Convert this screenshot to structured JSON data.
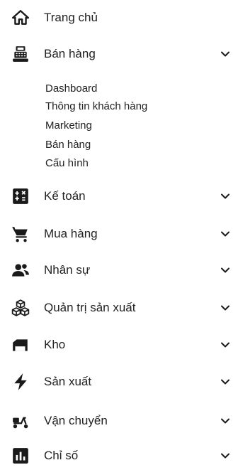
{
  "menu": {
    "items": [
      {
        "label": "Trang chủ",
        "icon": "home-icon"
      },
      {
        "label": "Bán hàng",
        "icon": "cash-register-icon"
      },
      {
        "label": "Kế toán",
        "icon": "calculator-icon"
      },
      {
        "label": "Mua hàng",
        "icon": "shopping-cart-icon"
      },
      {
        "label": "Nhân sự",
        "icon": "people-icon"
      },
      {
        "label": "Quản trị sản xuất",
        "icon": "cubes-icon"
      },
      {
        "label": "Kho",
        "icon": "warehouse-icon"
      },
      {
        "label": "Sản xuất",
        "icon": "lightning-bolt-icon"
      },
      {
        "label": "Vận chuyển",
        "icon": "delivery-scooter-icon"
      },
      {
        "label": "Chỉ số",
        "icon": "bar-chart-icon"
      }
    ],
    "sales_subitems": [
      {
        "label": "Dashboard"
      },
      {
        "label": "Thông tin khách hàng"
      },
      {
        "label": "Marketing"
      },
      {
        "label": "Bán hàng"
      },
      {
        "label": "Cấu hình"
      }
    ]
  },
  "colors": {
    "text": "#222222",
    "icon": "#1a1a1a",
    "background": "#ffffff"
  }
}
